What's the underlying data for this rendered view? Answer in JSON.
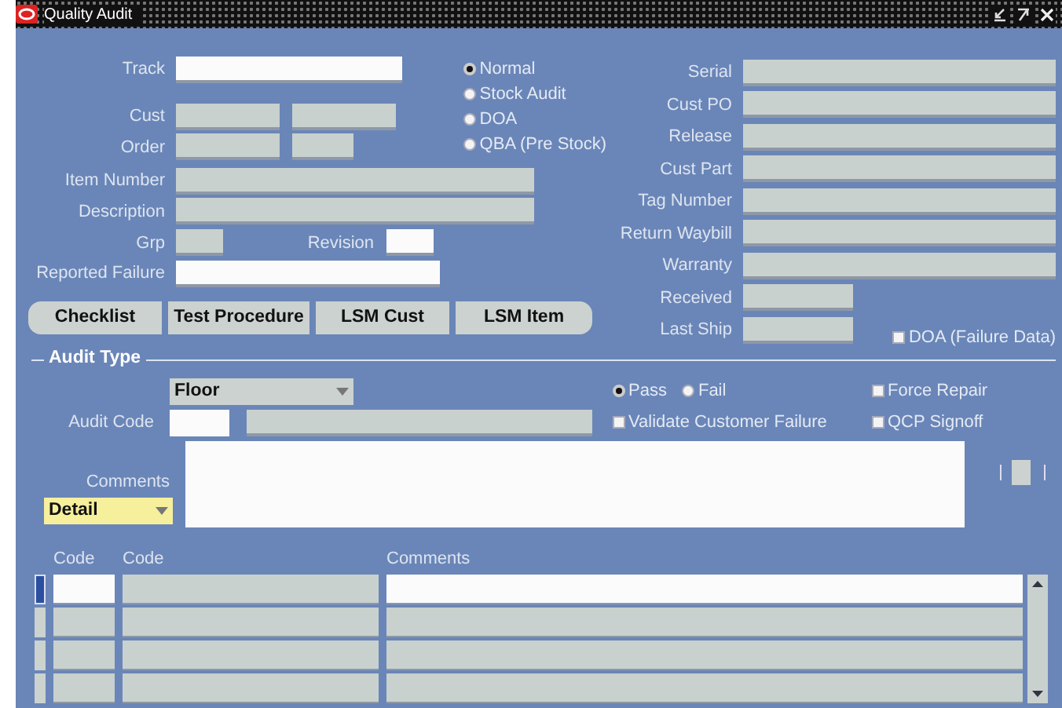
{
  "window": {
    "title": "Quality Audit"
  },
  "left_fields": [
    {
      "label": "Track",
      "inputs": [
        {
          "disabled": false
        }
      ]
    },
    {
      "label": "Cust",
      "inputs": [
        {
          "disabled": true
        },
        {
          "disabled": true
        }
      ]
    },
    {
      "label": "Order",
      "inputs": [
        {
          "disabled": true
        },
        {
          "disabled": true
        }
      ]
    },
    {
      "label": "Item Number",
      "inputs": [
        {
          "disabled": true
        }
      ]
    },
    {
      "label": "Description",
      "inputs": [
        {
          "disabled": true
        }
      ]
    },
    {
      "label": "Grp",
      "inputs": [
        {
          "disabled": true
        }
      ],
      "extra": {
        "label": "Revision",
        "disabled": false
      }
    },
    {
      "label": "Reported Failure",
      "inputs": [
        {
          "disabled": false
        }
      ]
    }
  ],
  "type_options": [
    {
      "label": "Normal",
      "selected": true
    },
    {
      "label": "Stock Audit",
      "selected": false
    },
    {
      "label": "DOA",
      "selected": false
    },
    {
      "label": "QBA (Pre Stock)",
      "selected": false
    }
  ],
  "right_fields": [
    {
      "label": "Serial",
      "disabled": true
    },
    {
      "label": "Cust PO",
      "disabled": true
    },
    {
      "label": "Release",
      "disabled": true
    },
    {
      "label": "Cust Part",
      "disabled": true
    },
    {
      "label": "Tag Number",
      "disabled": true
    },
    {
      "label": "Return Waybill",
      "disabled": true
    },
    {
      "label": "Warranty",
      "disabled": true
    },
    {
      "label": "Received",
      "disabled": true
    },
    {
      "label": "Last Ship",
      "disabled": true
    }
  ],
  "buttons": [
    "Checklist",
    "Test Procedure",
    "LSM Cust",
    "LSM Item"
  ],
  "doa_failure_data": {
    "label": "DOA (Failure Data)",
    "checked": false
  },
  "audit_type": {
    "title": "Audit Type",
    "type_select": {
      "value": "Floor"
    },
    "result_options": [
      {
        "label": "Pass",
        "selected": true
      },
      {
        "label": "Fail",
        "selected": false
      }
    ],
    "checkboxes": [
      {
        "label": "Force Repair",
        "checked": false
      },
      {
        "label": "Validate Customer Failure",
        "checked": false
      },
      {
        "label": "QCP Signoff",
        "checked": false
      }
    ],
    "audit_code": {
      "label": "Audit Code"
    },
    "comments": {
      "label": "Comments"
    },
    "view_select": {
      "value": "Detail"
    }
  },
  "detail_table": {
    "columns": [
      "Code",
      "Code",
      "Comments"
    ],
    "rows": [
      {
        "selected": true
      },
      {
        "selected": false
      },
      {
        "selected": false
      },
      {
        "selected": false
      }
    ]
  }
}
